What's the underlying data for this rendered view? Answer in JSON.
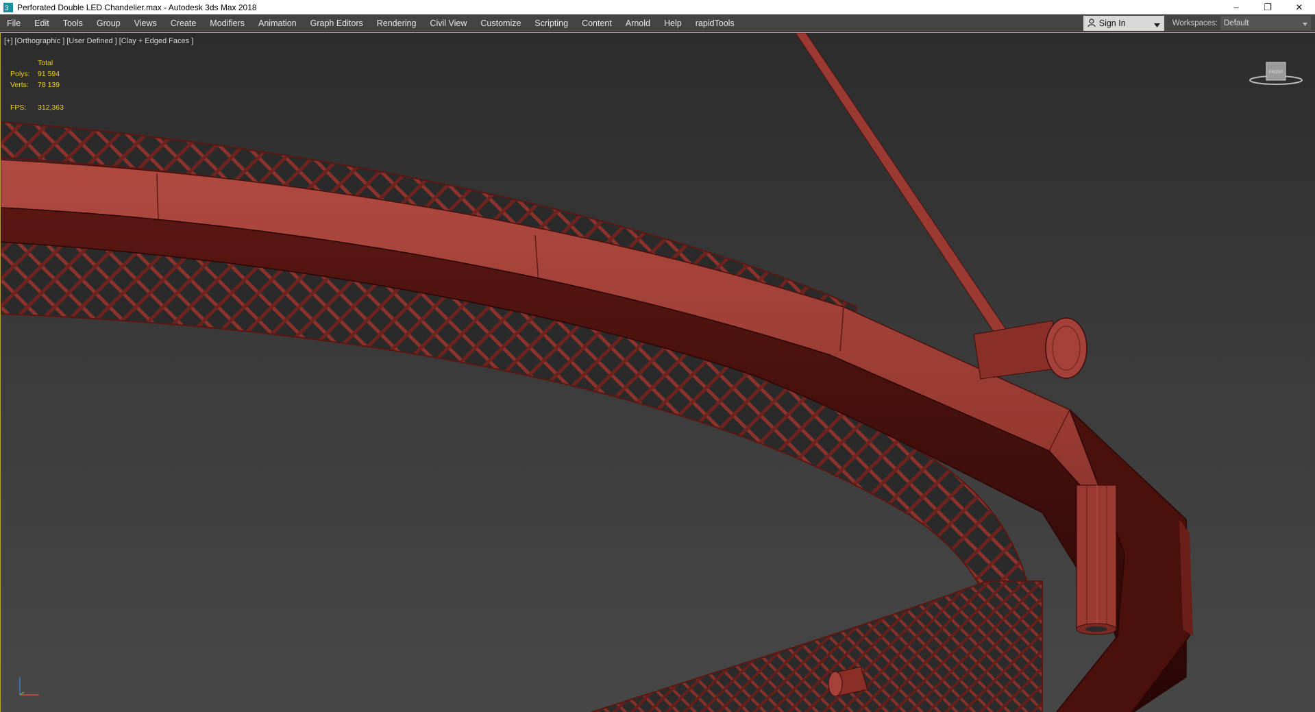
{
  "window": {
    "title": "Perforated Double LED Chandelier.max - Autodesk 3ds Max 2018",
    "app_icon": "3dsmax-icon",
    "controls": {
      "minimize": "–",
      "maximize": "❐",
      "close": "✕"
    }
  },
  "menubar": {
    "items": [
      "File",
      "Edit",
      "Tools",
      "Group",
      "Views",
      "Create",
      "Modifiers",
      "Animation",
      "Graph Editors",
      "Rendering",
      "Civil View",
      "Customize",
      "Scripting",
      "Content",
      "Arnold",
      "Help",
      "rapidTools"
    ],
    "sign_in": "Sign In",
    "workspaces_label": "Workspaces:",
    "workspace_value": "Default"
  },
  "viewport": {
    "labels": [
      "[+]",
      "[Orthographic ]",
      "[User Defined ]",
      "[Clay + Edged Faces ]"
    ],
    "stats": {
      "header": "Total",
      "polys_label": "Polys:",
      "polys_value": "91 594",
      "verts_label": "Verts:",
      "verts_value": "78 139",
      "fps_label": "FPS:",
      "fps_value": "312,363"
    },
    "viewcube_label": "FRONT",
    "colors": {
      "model_light": "#a3413a",
      "model_mid": "#7e2a24",
      "model_dark": "#3a0d0a",
      "highlight_border": "#b9a33a",
      "stats_text": "#f0d21c"
    }
  }
}
